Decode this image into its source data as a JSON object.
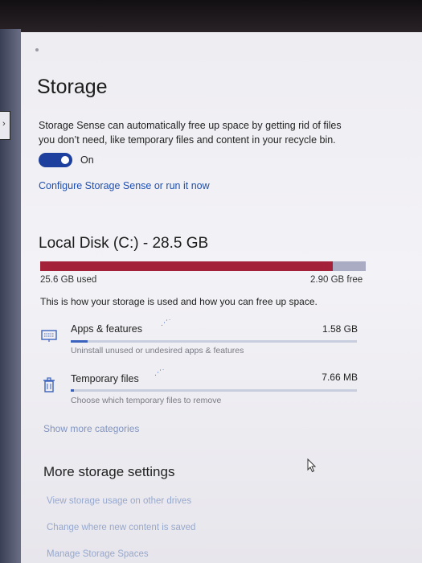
{
  "page": {
    "title": "Storage",
    "description": "Storage Sense can automatically free up space by getting rid of files you don’t need, like temporary files and content in your recycle bin.",
    "toggle": {
      "state_label": "On",
      "is_on": true
    },
    "configure_link": "Configure Storage Sense or run it now"
  },
  "disk": {
    "title": "Local Disk (C:) - 28.5 GB",
    "used_label": "25.6 GB used",
    "free_label": "2.90 GB free",
    "used_fraction": 0.898,
    "intro": "This is how your storage is used and how you can free up space."
  },
  "categories": [
    {
      "name": "Apps & features",
      "size": "1.58 GB",
      "subtitle": "Uninstall unused or undesired apps & features",
      "icon": "keyboard-icon",
      "fill_fraction": 0.06
    },
    {
      "name": "Temporary files",
      "size": "7.66 MB",
      "subtitle": "Choose which temporary files to remove",
      "icon": "trash-icon",
      "fill_fraction": 0.01
    }
  ],
  "show_more": "Show more categories",
  "more_settings": {
    "title": "More storage settings",
    "links": [
      "View storage usage on other drives",
      "Change where new content is saved",
      "Manage Storage Spaces"
    ]
  },
  "colors": {
    "accent": "#1d3f9e",
    "link": "#1f4fb0",
    "used_bar": "#a3223a",
    "free_bar": "#a9acc3"
  }
}
